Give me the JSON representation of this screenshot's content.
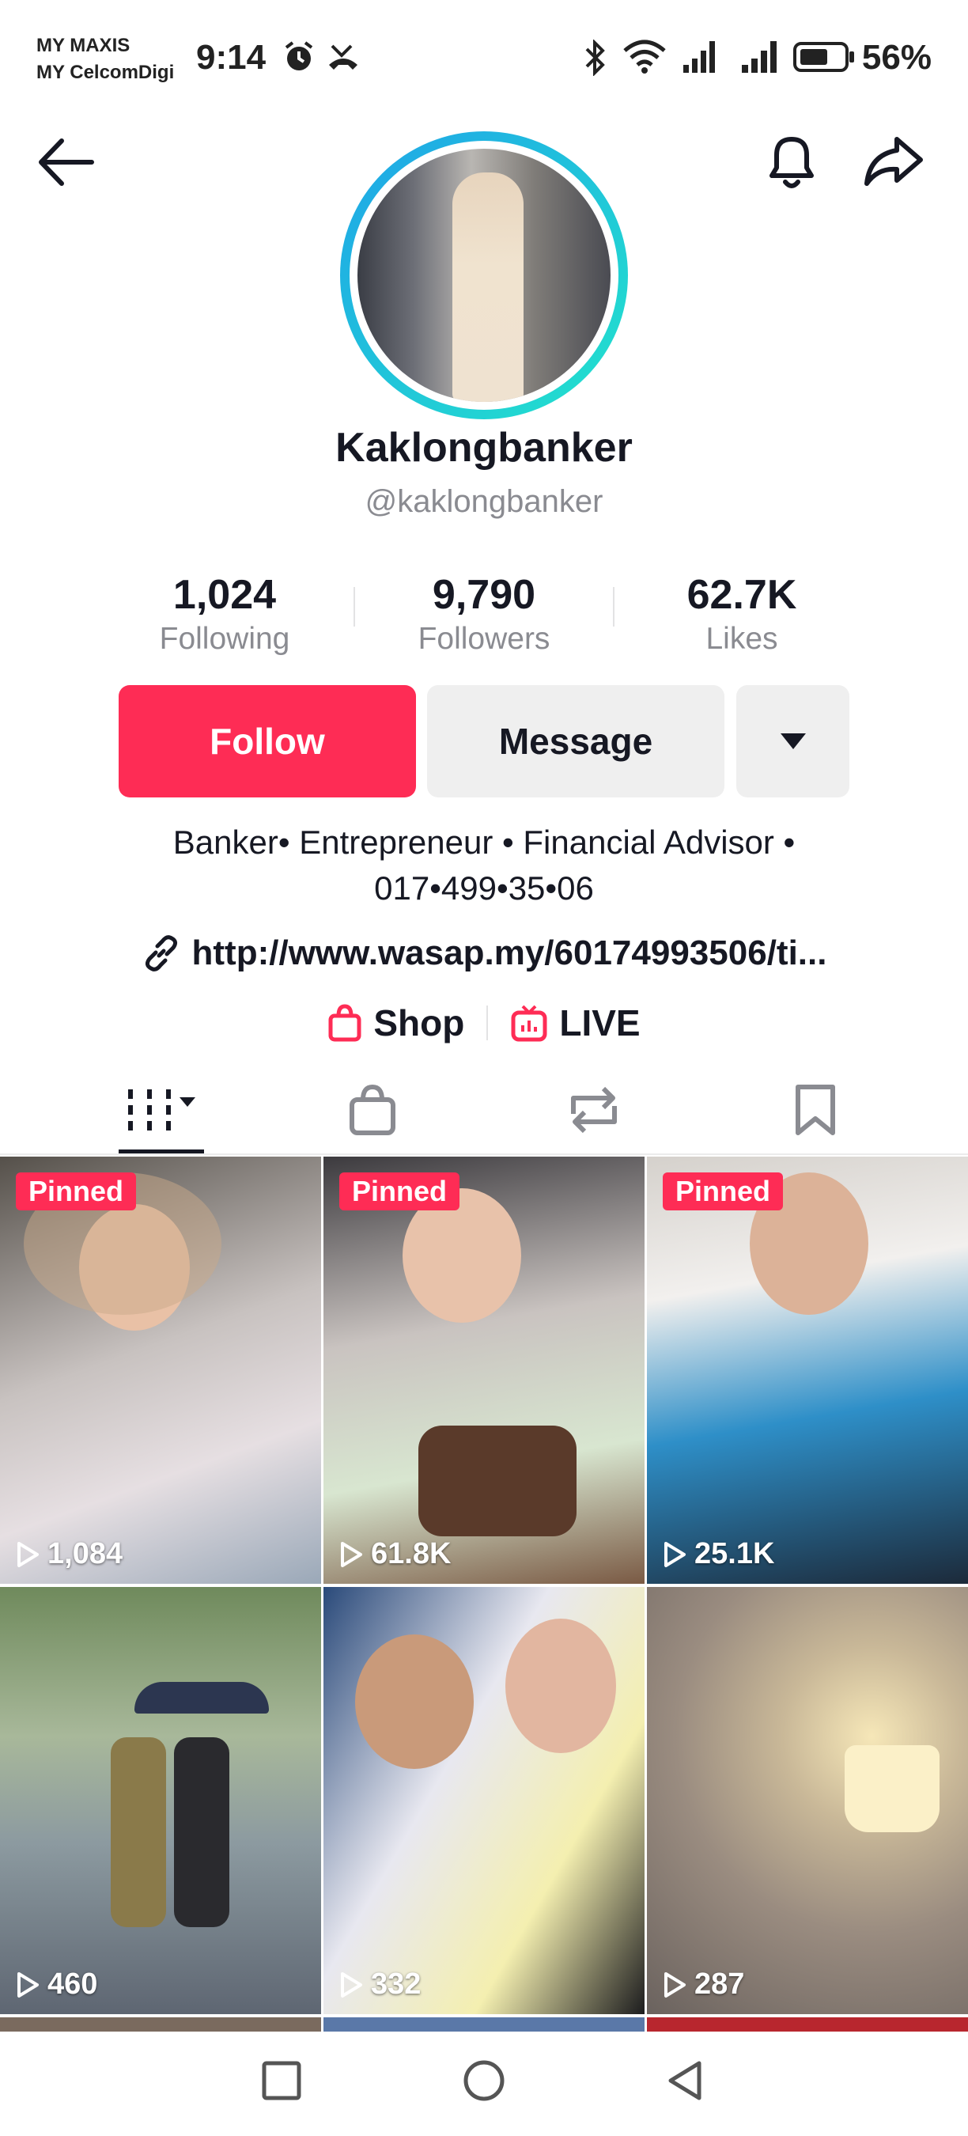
{
  "status_bar": {
    "carrier_1": "MY MAXIS",
    "carrier_2": "MY CelcomDigi",
    "time": "9:14",
    "battery": "56%"
  },
  "header": {
    "back_icon": "arrow-left-icon",
    "bell_icon": "bell-icon",
    "share_icon": "share-arrow-icon"
  },
  "profile": {
    "display_name": "Kaklongbanker",
    "handle": "@kaklongbanker",
    "stats": [
      {
        "value": "1,024",
        "label": "Following"
      },
      {
        "value": "9,790",
        "label": "Followers"
      },
      {
        "value": "62.7K",
        "label": "Likes"
      }
    ],
    "follow_label": "Follow",
    "message_label": "Message",
    "bio_line1": "Banker• Entrepreneur • Financial Advisor •",
    "bio_line2": "017•499•35•06",
    "link": "http://www.wasap.my/60174993506/ti...",
    "shop_label": "Shop",
    "live_label": "LIVE"
  },
  "tabs": [
    "videos-grid-icon",
    "shop-bag-icon",
    "repost-icon",
    "bookmark-icon"
  ],
  "videos": [
    {
      "pinned": "Pinned",
      "views": "1,084"
    },
    {
      "pinned": "Pinned",
      "views": "61.8K"
    },
    {
      "pinned": "Pinned",
      "views": "25.1K"
    },
    {
      "views": "460"
    },
    {
      "views": "332"
    },
    {
      "views": "287"
    }
  ],
  "colors": {
    "accent": "#fe2c55",
    "text": "#161823",
    "muted": "#8a8b91"
  }
}
